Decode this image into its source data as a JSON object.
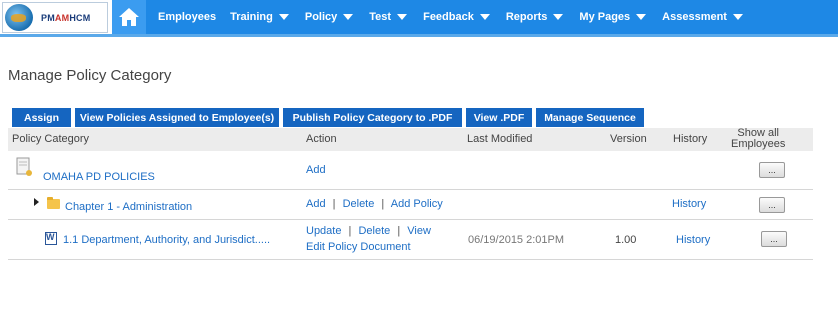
{
  "header": {
    "logo_text_1": "PM",
    "logo_text_2": "AM",
    "logo_text_3": "HCM",
    "nav": [
      {
        "label": "Employees",
        "has_menu": false
      },
      {
        "label": "Training",
        "has_menu": true
      },
      {
        "label": "Policy",
        "has_menu": true
      },
      {
        "label": "Test",
        "has_menu": true
      },
      {
        "label": "Feedback",
        "has_menu": true
      },
      {
        "label": "Reports",
        "has_menu": true
      },
      {
        "label": "My Pages",
        "has_menu": true
      },
      {
        "label": "Assessment",
        "has_menu": true
      }
    ]
  },
  "page": {
    "title": "Manage Policy Category"
  },
  "toolbar": {
    "assign": "Assign",
    "view_assigned": "View Policies Assigned to Employee(s)",
    "publish_pdf": "Publish Policy Category to .PDF",
    "view_pdf": "View .PDF",
    "manage_sequence": "Manage Sequence"
  },
  "table": {
    "headers": {
      "category": "Policy Category",
      "action": "Action",
      "last_modified": "Last Modified",
      "version": "Version",
      "history": "History",
      "show_all_1": "Show all",
      "show_all_2": "Employees"
    },
    "rows": [
      {
        "name": "OMAHA PD POLICIES",
        "actions": {
          "add": "Add"
        },
        "last_modified": "",
        "version": "",
        "history": "",
        "more": "..."
      },
      {
        "name": "Chapter 1 - Administration",
        "actions": {
          "add": "Add",
          "delete": "Delete",
          "add_policy": "Add Policy"
        },
        "last_modified": "",
        "version": "",
        "history": "History",
        "more": "..."
      },
      {
        "name": "1.1 Department, Authority, and Jurisdict.....",
        "actions": {
          "update": "Update",
          "delete": "Delete",
          "view": "View",
          "edit": "Edit Policy Document"
        },
        "last_modified": "06/19/2015 2:01PM",
        "version": "1.00",
        "history": "History",
        "more": "..."
      }
    ]
  },
  "separator": "|",
  "colors": {
    "nav_bg": "#1e88e5",
    "button_bg": "#1565c0",
    "link": "#1e6ec5"
  }
}
